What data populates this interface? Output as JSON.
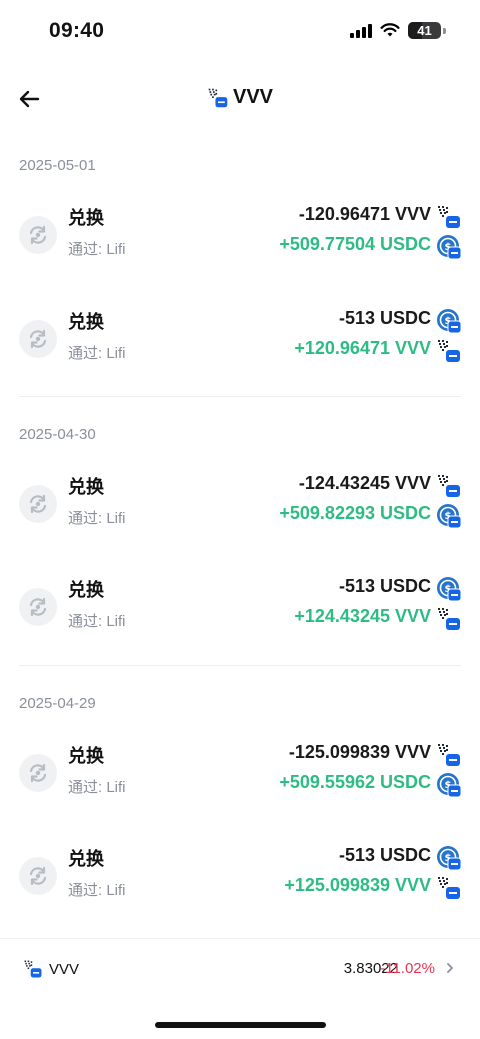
{
  "status_bar": {
    "time": "09:40",
    "battery": "41"
  },
  "header": {
    "title": "VVV",
    "token_icon": "vvv-token-icon"
  },
  "groups": [
    {
      "date": "2025-05-01",
      "transactions": [
        {
          "type": "兑换",
          "via": "通过: Lifi",
          "out": "-120.96471 VVV",
          "out_icon": "vvv-token-icon",
          "in": "+509.77504 USDC",
          "in_icon": "usdc-token-icon"
        },
        {
          "type": "兑换",
          "via": "通过: Lifi",
          "out": "-513 USDC",
          "out_icon": "usdc-token-icon",
          "in": "+120.96471 VVV",
          "in_icon": "vvv-token-icon"
        }
      ]
    },
    {
      "date": "2025-04-30",
      "transactions": [
        {
          "type": "兑换",
          "via": "通过: Lifi",
          "out": "-124.43245 VVV",
          "out_icon": "vvv-token-icon",
          "in": "+509.82293 USDC",
          "in_icon": "usdc-token-icon"
        },
        {
          "type": "兑换",
          "via": "通过: Lifi",
          "out": "-513 USDC",
          "out_icon": "usdc-token-icon",
          "in": "+124.43245 VVV",
          "in_icon": "vvv-token-icon"
        }
      ]
    },
    {
      "date": "2025-04-29",
      "transactions": [
        {
          "type": "兑换",
          "via": "通过: Lifi",
          "out": "-125.099839 VVV",
          "out_icon": "vvv-token-icon",
          "in": "+509.55962 USDC",
          "in_icon": "usdc-token-icon"
        },
        {
          "type": "兑换",
          "via": "通过: Lifi",
          "out": "-513 USDC",
          "out_icon": "usdc-token-icon",
          "in": "+125.099839 VVV",
          "in_icon": "vvv-token-icon"
        }
      ]
    }
  ],
  "bottom_bar": {
    "token": "VVV",
    "price": "3.83022",
    "change": "-11.02%"
  },
  "colors": {
    "positive": "#2dbc84",
    "negative": "#e9334f",
    "muted": "#8a8f99",
    "usdc_blue": "#2775ca"
  }
}
